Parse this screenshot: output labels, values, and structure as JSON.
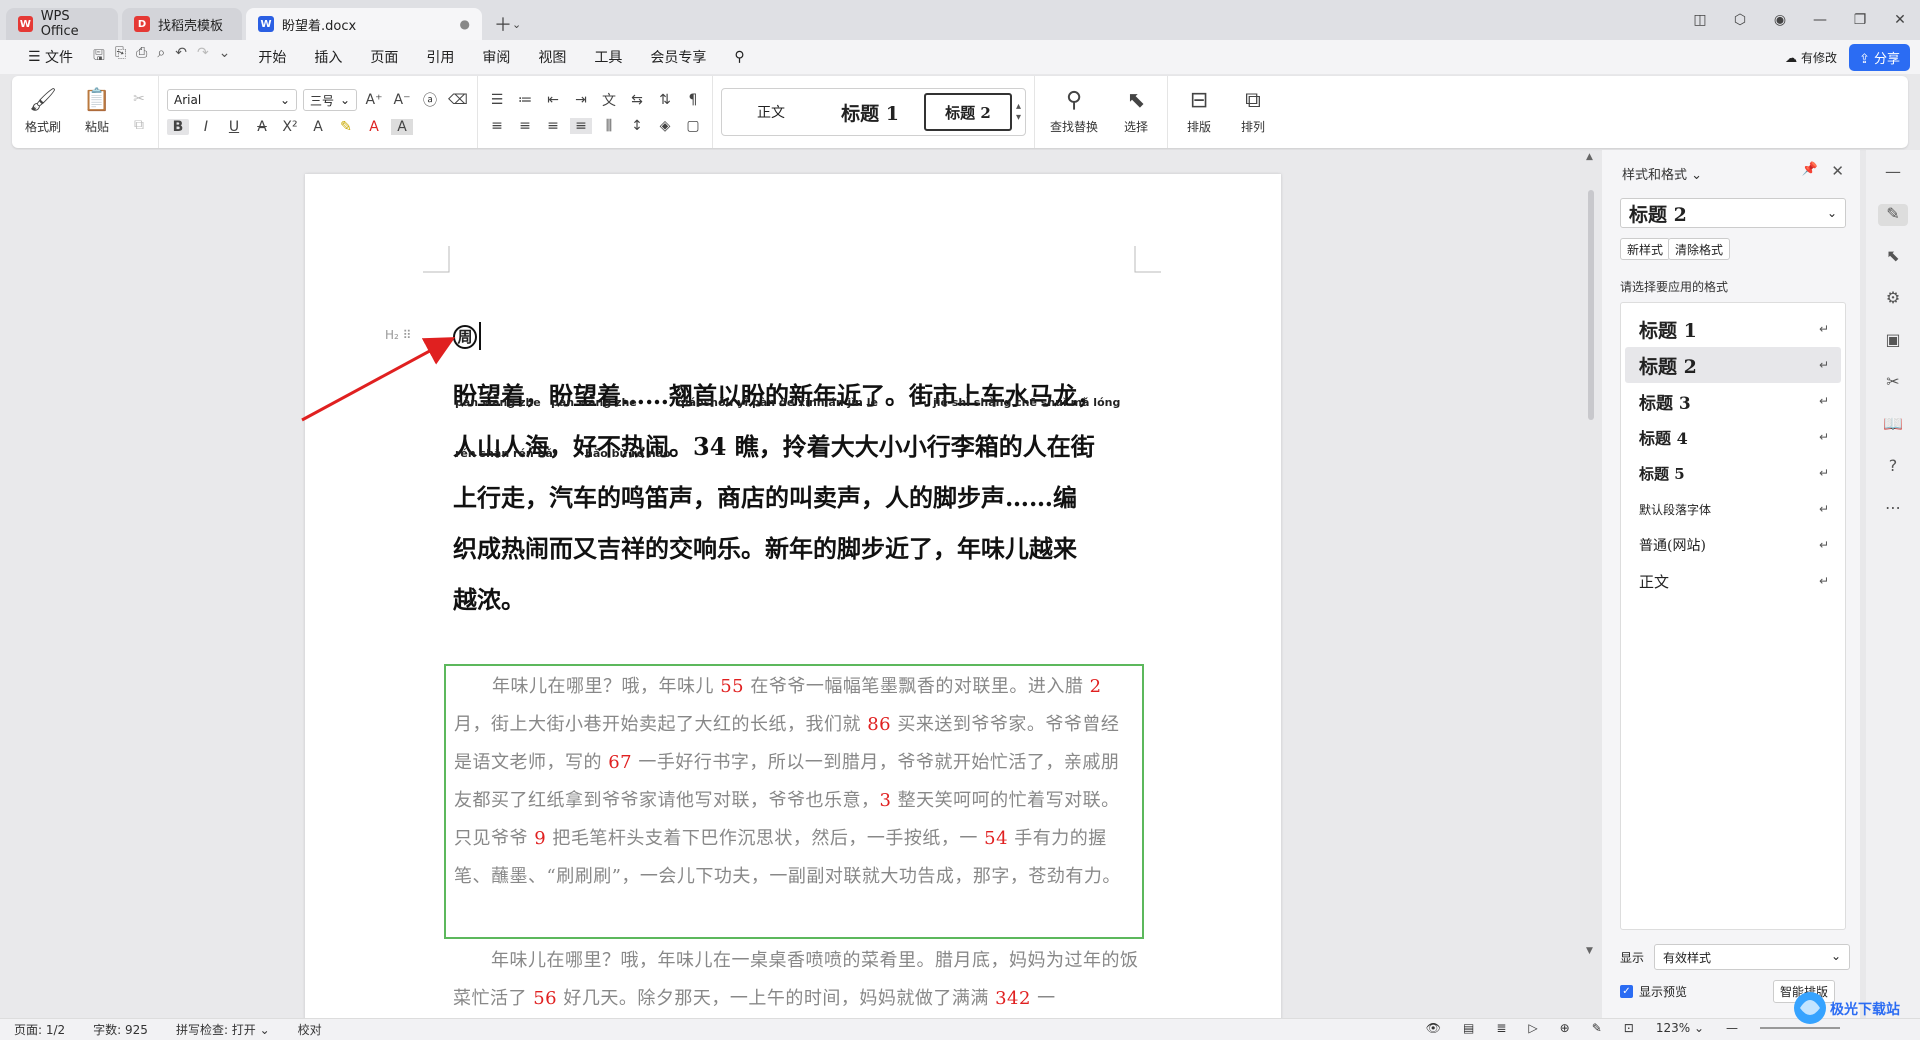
{
  "tabs": [
    {
      "label": "WPS Office",
      "icon": "wps-logo-icon",
      "color": "#e53935"
    },
    {
      "label": "找稻壳模板",
      "icon": "docer-icon",
      "color": "#e53935"
    },
    {
      "label": "盼望着.docx",
      "icon": "word-doc-icon",
      "color": "#2b5fe3"
    }
  ],
  "menu": {
    "file": "文件",
    "items": [
      "开始",
      "插入",
      "页面",
      "引用",
      "审阅",
      "视图",
      "工具",
      "会员专享"
    ],
    "active": "开始",
    "modified": "有修改",
    "share": "分享"
  },
  "ribbon": {
    "format_painter": "格式刷",
    "paste": "粘贴",
    "font_name": "Arial",
    "font_size": "三号",
    "styles": {
      "normal": "正文",
      "h1": "标题 1",
      "h2": "标题 2"
    },
    "find_replace": "查找替换",
    "select": "选择",
    "layout": "排版",
    "arrange": "排列"
  },
  "document": {
    "h2_marker": "H₂",
    "heading_char": "周",
    "bold_lines": [
      "盼望着，盼望着……翘首以盼的新年近了。街市上车水马龙，",
      "人山人海，好不热闹。34 瞧，拎着大大小小行李箱的人在街",
      "上行走，汽车的鸣笛声，商店的叫卖声，人的脚步声……编",
      "织成热闹而又吉祥的交响乐。新年的脚步近了，年味儿越来",
      "越浓。"
    ],
    "pinyin_line1": [
      "pàn wàng zhe",
      "pàn wàng zhe",
      "qiáoshǒu yǐ  pàn  de  xīnnián jìn  le",
      "jiē shì shàng chē shuǐ mǎ lóng"
    ],
    "pinyin_line2": [
      "rén shān rén hǎi",
      "hǎo  bù   rè  nào"
    ],
    "box_text": [
      {
        "t": "年味儿在哪里？哦，年味儿 "
      },
      {
        "t": "55",
        "red": true
      },
      {
        "t": " 在爷爷一幅幅笔墨飘香的对联里。进入腊 "
      },
      {
        "t": "2",
        "red": true
      },
      {
        "t": " 月，街上大街小巷开始卖起了大红的长纸，我们就 "
      },
      {
        "t": "86",
        "red": true
      },
      {
        "t": " 买来送到爷爷家。爷爷曾经是语文老师，写的 "
      },
      {
        "t": "67",
        "red": true
      },
      {
        "t": " 一手好行书字，所以一到腊月，爷爷就开始忙活了，亲戚朋友都买了红纸拿到爷爷家请他写对联，爷爷也乐意，"
      },
      {
        "t": "3",
        "red": true
      },
      {
        "t": " 整天笑呵呵的忙着写对联。只见爷爷 "
      },
      {
        "t": "9",
        "red": true
      },
      {
        "t": " 把毛笔杆头支着下巴作沉思状，然后，一手按纸，一 "
      },
      {
        "t": "54",
        "red": true
      },
      {
        "t": " 手有力的握笔、蘸墨、“刷刷刷”，一会儿下功夫，一副副对联就大功告成，那字，苍劲有力。"
      }
    ],
    "para2_text": [
      {
        "t": "年味儿在哪里？哦，年味儿在一桌桌香喷喷的菜肴里。腊月底，妈妈为过年的饭菜忙活了 "
      },
      {
        "t": "56",
        "red": true
      },
      {
        "t": " 好几天。除夕那天，一上午的时间，妈妈就做了满满 "
      },
      {
        "t": "342",
        "red": true
      },
      {
        "t": " 一"
      }
    ]
  },
  "panel": {
    "title": "样式和格式",
    "current": "标题 2",
    "new_style": "新样式",
    "clear_format": "清除格式",
    "hint": "请选择要应用的格式",
    "styles": [
      {
        "label": "标题 1",
        "weight": "h",
        "size": 19
      },
      {
        "label": "标题 2",
        "weight": "h",
        "size": 19,
        "selected": true
      },
      {
        "label": "标题 3",
        "weight": "h",
        "size": 17
      },
      {
        "label": "标题 4",
        "weight": "h",
        "size": 16
      },
      {
        "label": "标题 5",
        "weight": "h",
        "size": 15
      },
      {
        "label": "默认段落字体",
        "weight": "n",
        "size": 12
      },
      {
        "label": "普通(网站)",
        "weight": "n",
        "size": 14
      },
      {
        "label": "正文",
        "weight": "n",
        "size": 15
      }
    ],
    "display_label": "显示",
    "display_value": "有效样式",
    "preview_label": "显示预览",
    "smart_layout": "智能排版"
  },
  "status": {
    "page": "页面: 1/2",
    "words": "字数: 925",
    "spell": "拼写检查: 打开",
    "proof": "校对",
    "zoom": "123%"
  },
  "watermark": "极光下载站"
}
